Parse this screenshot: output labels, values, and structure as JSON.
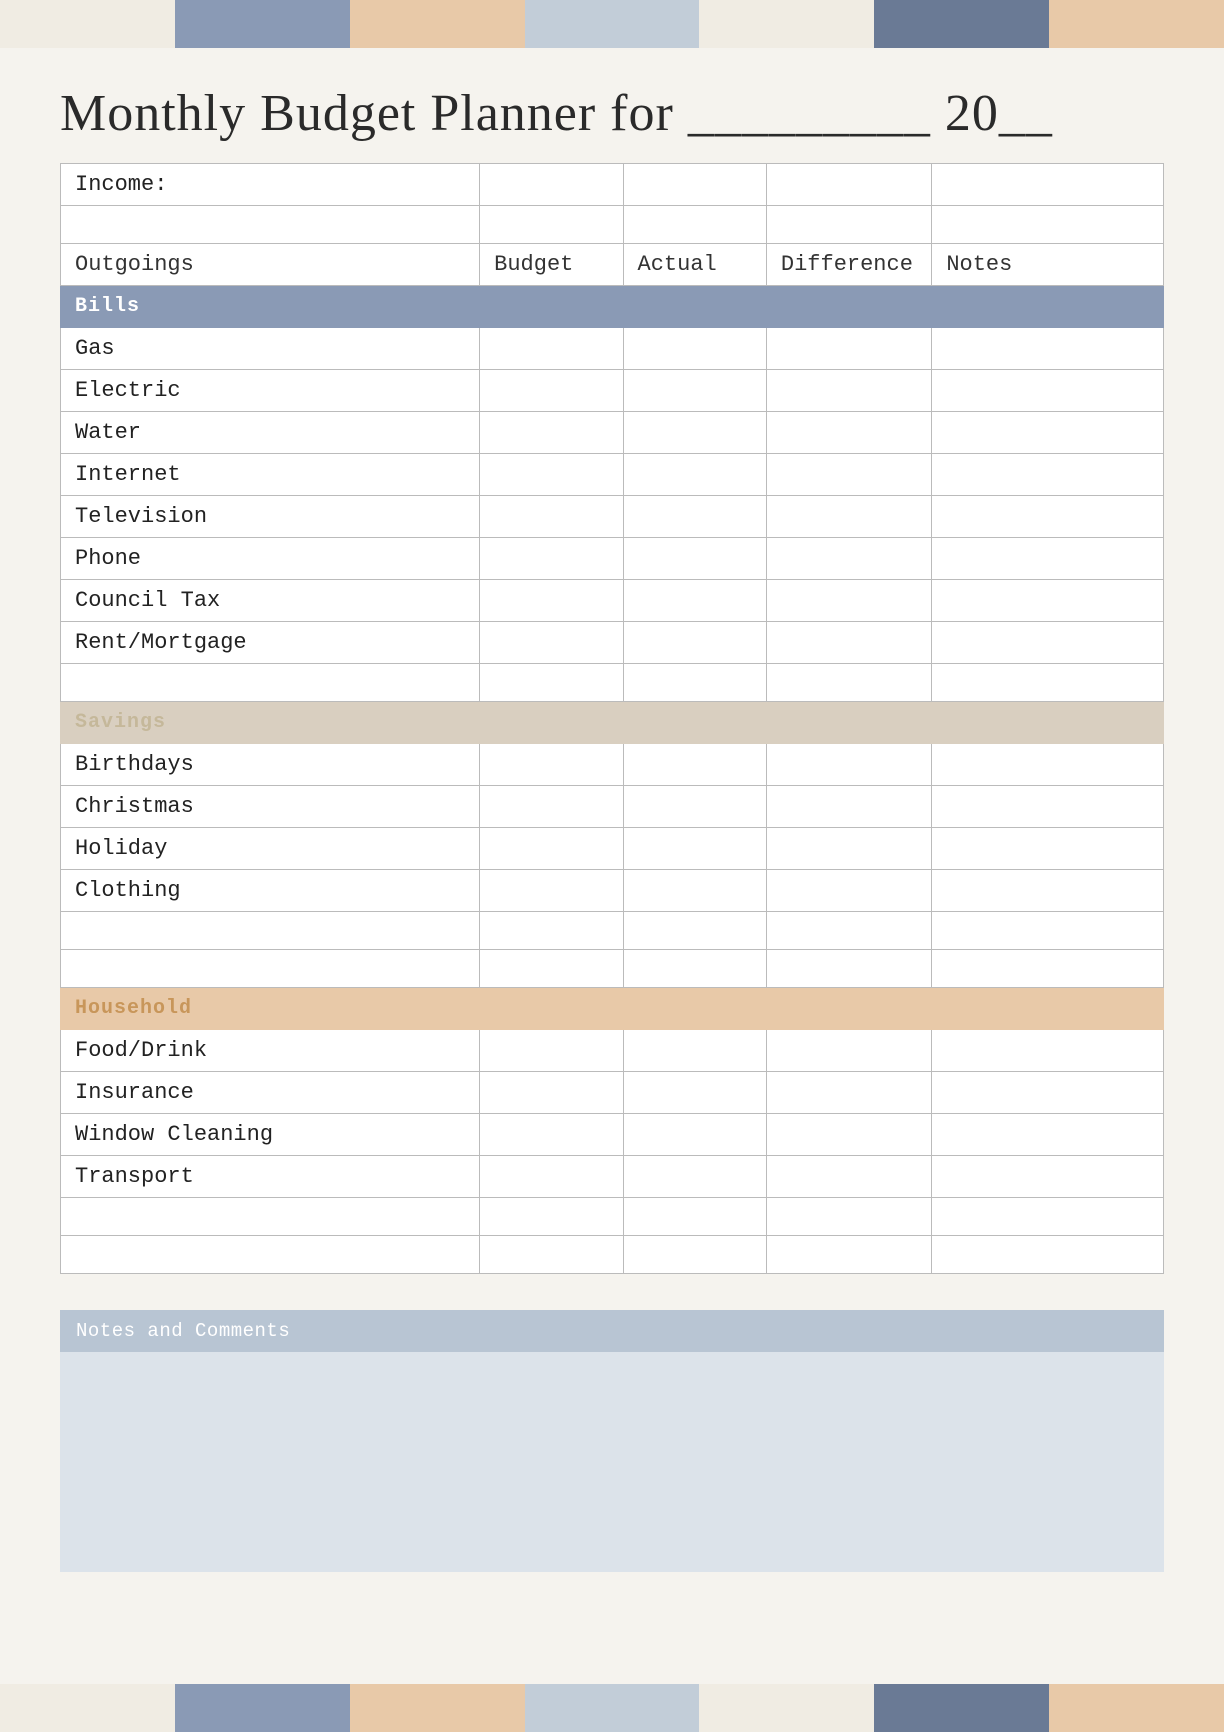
{
  "page": {
    "title": "Monthly Budget Planner for _________ 20__",
    "color_bars": {
      "top": [
        "#f0ece3",
        "#8a9ab5",
        "#e8c9a8",
        "#c2cdd8",
        "#f0ece3",
        "#6a7a95",
        "#e8c9a8"
      ],
      "bottom": [
        "#f0ece3",
        "#8a9ab5",
        "#e8c9a8",
        "#c2cdd8",
        "#f0ece3",
        "#6a7a95",
        "#e8c9a8"
      ]
    }
  },
  "table": {
    "income_label": "Income:",
    "columns": {
      "outgoings": "Outgoings",
      "budget": "Budget",
      "actual": "Actual",
      "difference": "Difference",
      "notes": "Notes"
    },
    "sections": [
      {
        "name": "Bills",
        "type": "bills",
        "items": [
          "Gas",
          "Electric",
          "Water",
          "Internet",
          "Television",
          "Phone",
          "Council Tax",
          "Rent/Mortgage"
        ]
      },
      {
        "name": "Savings",
        "type": "savings",
        "items": [
          "Birthdays",
          "Christmas",
          "Holiday",
          "Clothing"
        ]
      },
      {
        "name": "Household",
        "type": "household",
        "items": [
          "Food/Drink",
          "Insurance",
          "Window Cleaning",
          "Transport"
        ]
      }
    ]
  },
  "notes": {
    "header": "Notes and Comments",
    "body": ""
  }
}
